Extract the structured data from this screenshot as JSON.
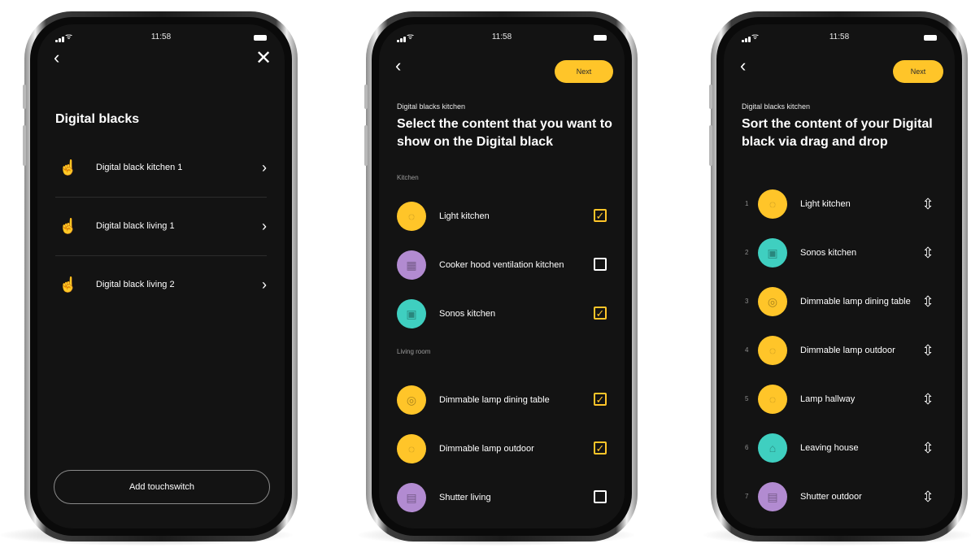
{
  "status": {
    "time": "11:58",
    "wifi_icon": "wifi-icon",
    "battery_icon": "battery-icon"
  },
  "screen1": {
    "title": "Digital blacks",
    "items": [
      {
        "label": "Digital black kitchen 1",
        "icon": "touch-panel-icon"
      },
      {
        "label": "Digital black living 1",
        "icon": "touch-panel-icon"
      },
      {
        "label": "Digital black living 2",
        "icon": "touch-panel-icon"
      }
    ],
    "add_button": "Add touchswitch"
  },
  "screen2": {
    "next_label": "Next",
    "subtitle": "Digital blacks kitchen",
    "heading": "Select the content that you want to show on the Digital black",
    "sections": [
      {
        "label": "Kitchen",
        "items": [
          {
            "label": "Light kitchen",
            "color": "#ffc529",
            "icon": "bulb-icon",
            "checked": true
          },
          {
            "label": "Cooker hood ventilation kitchen",
            "color": "#b28bd1",
            "icon": "ventilation-icon",
            "checked": false
          },
          {
            "label": "Sonos kitchen",
            "color": "#3fcfc0",
            "icon": "speaker-icon",
            "checked": true
          }
        ]
      },
      {
        "label": "Living room",
        "items": [
          {
            "label": "Dimmable lamp dining table",
            "color": "#ffc529",
            "icon": "dimmable-bulb-icon",
            "checked": true
          },
          {
            "label": "Dimmable lamp outdoor",
            "color": "#ffc529",
            "icon": "bulb-icon",
            "checked": true
          },
          {
            "label": "Shutter living",
            "color": "#b28bd1",
            "icon": "shutter-icon",
            "checked": false
          }
        ]
      }
    ]
  },
  "screen3": {
    "next_label": "Next",
    "subtitle": "Digital blacks kitchen",
    "heading": "Sort the content of your Digital black via drag and drop",
    "items": [
      {
        "num": "1",
        "label": "Light kitchen",
        "color": "#ffc529",
        "icon": "bulb-icon"
      },
      {
        "num": "2",
        "label": "Sonos kitchen",
        "color": "#3fcfc0",
        "icon": "speaker-icon"
      },
      {
        "num": "3",
        "label": "Dimmable lamp dining table",
        "color": "#ffc529",
        "icon": "dimmable-bulb-icon"
      },
      {
        "num": "4",
        "label": "Dimmable lamp outdoor",
        "color": "#ffc529",
        "icon": "bulb-icon"
      },
      {
        "num": "5",
        "label": "Lamp hallway",
        "color": "#ffc529",
        "icon": "bulb-icon"
      },
      {
        "num": "6",
        "label": "Leaving house",
        "color": "#3fcfc0",
        "icon": "house-icon"
      },
      {
        "num": "7",
        "label": "Shutter outdoor",
        "color": "#b28bd1",
        "icon": "shutter-icon"
      }
    ]
  }
}
